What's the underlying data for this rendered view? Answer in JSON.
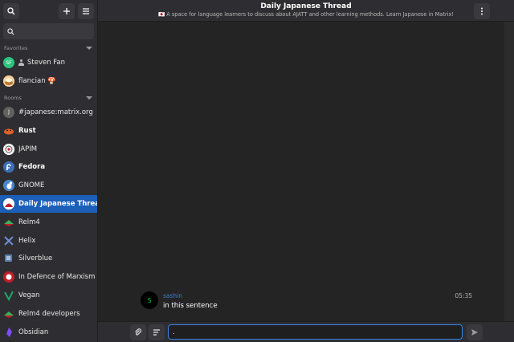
{
  "sidebar": {
    "sections": {
      "favorites": "Favorites",
      "rooms": "Rooms"
    },
    "favorites": [
      {
        "label": "Steven Fan",
        "initials": "SF",
        "color": "#2ec27e"
      },
      {
        "label": "flancian 🍄",
        "color": "#e8a060"
      }
    ],
    "rooms": [
      {
        "label": "#japanese:matrix.org",
        "initials": "J",
        "color": "#616161"
      },
      {
        "label": "Rust",
        "color": "#e0632a",
        "bold": true
      },
      {
        "label": "JAPIM",
        "color": "#f5f5f5"
      },
      {
        "label": "Fedora",
        "color": "#3c6eb4",
        "bold": true
      },
      {
        "label": "GNOME",
        "color": "#4a86cf"
      },
      {
        "label": "Daily Japanese Thread",
        "color": "#c01c28",
        "selected": true
      },
      {
        "label": "Relm4",
        "color": "#3fae5c"
      },
      {
        "label": "Helix",
        "color": "#6b8fd6"
      },
      {
        "label": "Silverblue",
        "color": "#5b7fa6"
      },
      {
        "label": "In Defence of Marxism",
        "color": "#c01c28"
      },
      {
        "label": "Vegan",
        "color": "#26a269"
      },
      {
        "label": "Relm4 developers",
        "color": "#3fae5c"
      },
      {
        "label": "Obsidian",
        "color": "#7c4dff"
      }
    ]
  },
  "header": {
    "title": "Daily Japanese Thread",
    "topic": "🇯🇵 A space for language learners to discuss about AJATT and other learning methods. Learn Japanese in Matrix!"
  },
  "timeline": {
    "messages": [
      {
        "sender": "sashin",
        "initial": "S",
        "time": "05:35",
        "body": "in this sentence"
      }
    ]
  },
  "composer": {
    "value": "."
  },
  "colors": {
    "accent": "#3584e4",
    "selected": "#1c5fb8",
    "sidebar_bg": "#2e2e32",
    "main_bg": "#242424"
  }
}
